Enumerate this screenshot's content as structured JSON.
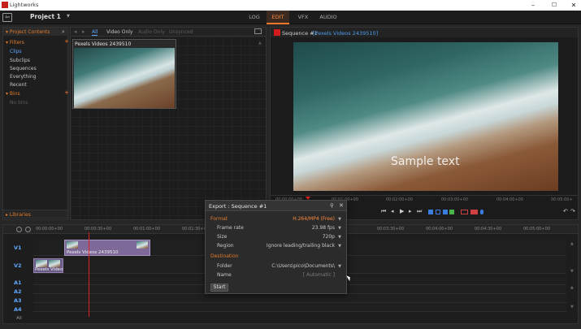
{
  "window": {
    "title": "Lightworks",
    "minimize": "–",
    "maximize": "☐",
    "close": "✕"
  },
  "appbar": {
    "exit_icon": "⇦",
    "project_title": "Project 1",
    "project_caret": "▼",
    "tabs": [
      "LOG",
      "EDIT",
      "VFX",
      "AUDIO"
    ],
    "active_tab": "EDIT"
  },
  "sidebar": {
    "header": "▾ Project Contents",
    "search_icon": "⌕",
    "filters_label": "▾ Filters",
    "filters": [
      "Clips",
      "Subclips",
      "Sequences",
      "Everything",
      "Recent"
    ],
    "active_filter": "Clips",
    "bins_label": "▾ Bins",
    "no_bins": "No bins",
    "libraries_label": "▸ Libraries",
    "plus": "+"
  },
  "browser": {
    "back": "◂",
    "forward": "▸",
    "tabs": [
      "All",
      "Video Only",
      "Audio Only",
      "Unsynced"
    ],
    "active_tab": "All",
    "clip_label": "Pexels Videos 2439510"
  },
  "viewer": {
    "sequence": "Sequence #1",
    "source": "[Pexels Videos 2439510]",
    "overlay_text": "Sample text",
    "ruler": [
      "00:00:00+00",
      "00:01:00+00",
      "00:02:00+00",
      "00:03:00+00",
      "00:04:00+00",
      "00:05:00+"
    ],
    "transport": [
      "⏮",
      "◂",
      "▶",
      "▸",
      "⏭"
    ],
    "mark_colors": [
      "#3c7ee0",
      "#3c7ee0",
      "#3c7ee0",
      "#48b44a",
      "#d04040",
      "#d04040",
      "#3c7ee0"
    ],
    "undo": "↶",
    "redo": "↷"
  },
  "timeline": {
    "zoom_out": "−",
    "zoom_in": "+",
    "ruler": [
      "00:00:00+00",
      "00:00:30+00",
      "00:01:00+00",
      "00:01:30+00",
      "00:03:30+00",
      "00:04:00+00",
      "00:04:30+00",
      "00:05:00+00"
    ],
    "tracks": [
      "V1",
      "V2",
      "A1",
      "A2",
      "A3",
      "A4"
    ],
    "all_label": "All",
    "clip_v1_label": "Pexels Videos 2439510",
    "clip_v2_label": "Pexels Video",
    "scroll_up": "▲",
    "scroll_down": "▼"
  },
  "export": {
    "title": "Export : Sequence #1",
    "pin_icon": "📌",
    "close_icon": "✕",
    "format_section": "Format",
    "format_value": "H.264/MP4 (Free)",
    "frame_rate_label": "Frame rate",
    "frame_rate_value": "23.98 fps",
    "size_label": "Size",
    "size_value": "720p",
    "region_label": "Region",
    "region_value": "Ignore leading/trailing black",
    "destination_section": "Destination",
    "folder_label": "Folder",
    "folder_value": "C:\\Users\\pico\\Documents\\",
    "name_label": "Name",
    "name_value": "[ Automatic ]",
    "caret": "▼",
    "start_label": "Start"
  },
  "colors": {
    "accent_orange": "#ff7a28",
    "accent_blue": "#5fa8ff",
    "clip_purple": "#7d6a98",
    "playhead_red": "#e02020"
  }
}
